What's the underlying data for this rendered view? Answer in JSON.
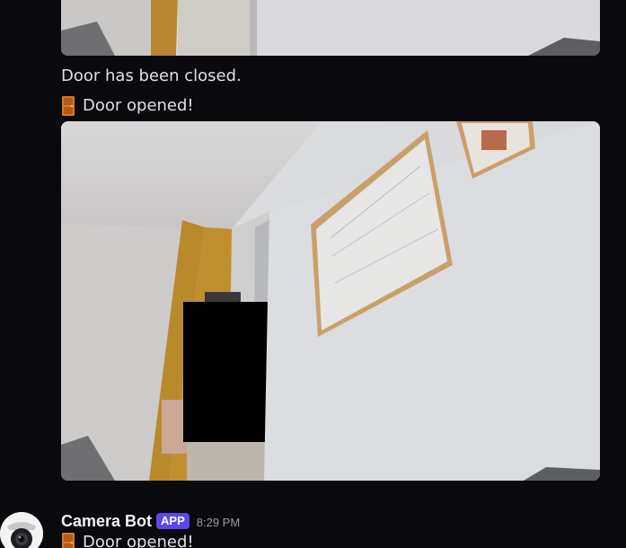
{
  "messages": {
    "closed_text": "Door has been closed.",
    "opened_text_1": "Door opened!",
    "opened_text_2": "Door opened!"
  },
  "header": {
    "author": "Camera Bot",
    "badge": "APP",
    "timestamp": "8:29 PM"
  },
  "icons": {
    "door": "door-emoji-icon",
    "avatar": "security-camera-icon"
  },
  "colors": {
    "background": "#0a090d",
    "text": "#dfe0e4",
    "badge": "#5b48e8",
    "timestamp": "#9a9ba3",
    "door_icon": "#d9782a"
  }
}
